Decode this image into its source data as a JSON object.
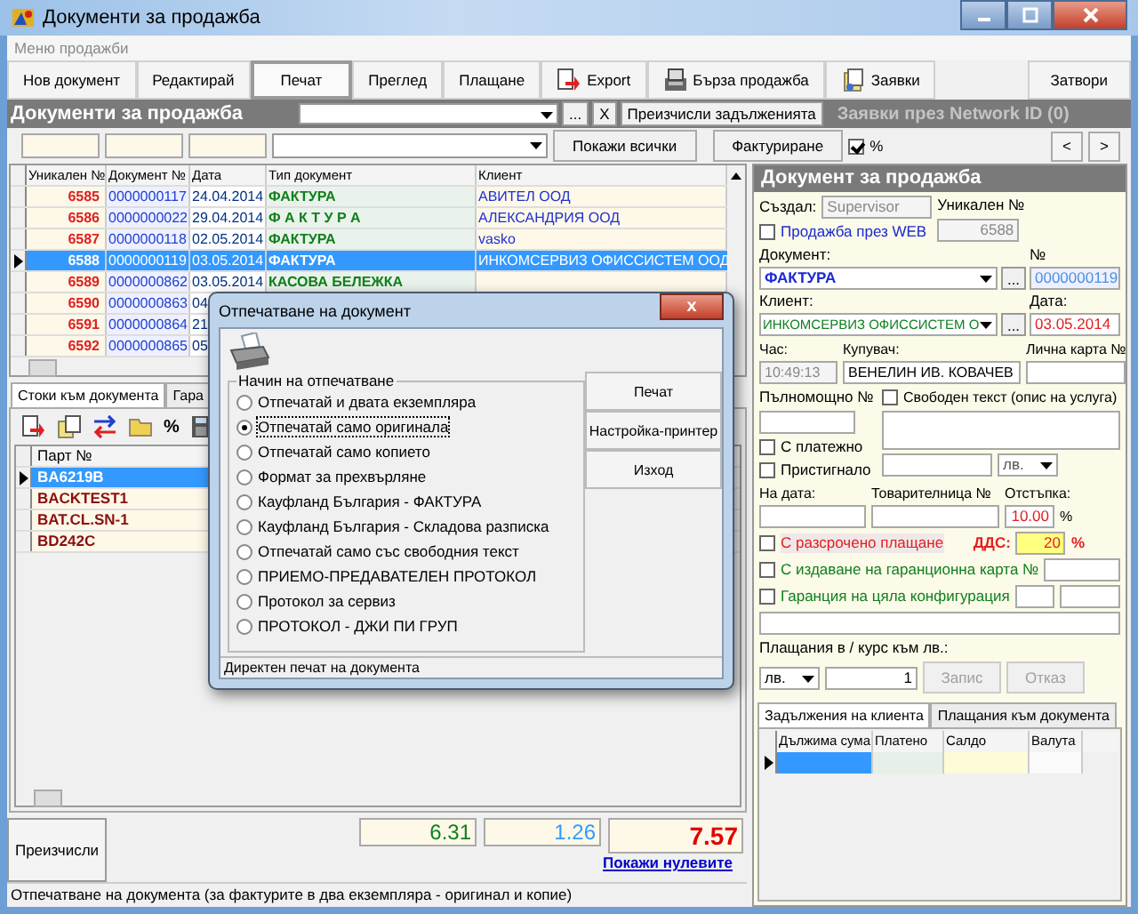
{
  "window": {
    "title": "Документи за продажба"
  },
  "menu": [
    "Меню продажби"
  ],
  "toolbar": [
    {
      "label": "Нов документ",
      "kind": "text",
      "selected": false
    },
    {
      "label": "Редактирай",
      "kind": "text",
      "selected": false
    },
    {
      "label": "Печат",
      "kind": "text",
      "selected": true
    },
    {
      "label": "Преглед",
      "kind": "text",
      "selected": false
    },
    {
      "label": "Плащане",
      "kind": "text",
      "selected": false
    },
    {
      "label": "Export",
      "kind": "export",
      "selected": false
    },
    {
      "label": "Бърза продажба",
      "kind": "register",
      "selected": false
    },
    {
      "label": "Заявки",
      "kind": "orders",
      "selected": false
    },
    {
      "label": "Затвори",
      "kind": "right",
      "selected": false
    }
  ],
  "list_header": {
    "title": "Документи за продажба",
    "ellipsis": "...",
    "clear": "X",
    "recalc_button": "Преизчисли задълженията",
    "network_label": "Заявки през Network ID (0)"
  },
  "filter": {
    "show_all": "Покажи всички",
    "invoicing": "Фактуриране",
    "percent": {
      "label": "%",
      "checked": true
    },
    "prev": "<",
    "next": ">"
  },
  "documents": {
    "columns": [
      "Уникален №",
      "Документ №",
      "Дата",
      "Тип документ",
      "Клиент"
    ],
    "rows": [
      {
        "unique": "6585",
        "number": "0000000117",
        "date": "24.04.2014",
        "type": "ФАКТУРА",
        "client": "АВИТЕЛ ООД",
        "selected": false
      },
      {
        "unique": "6586",
        "number": "0000000022",
        "date": "29.04.2014",
        "type": "Ф А К Т У Р А",
        "client": "АЛЕКСАНДРИЯ ООД",
        "selected": false
      },
      {
        "unique": "6587",
        "number": "0000000118",
        "date": "02.05.2014",
        "type": "ФАКТУРА",
        "client": "vasko",
        "selected": false
      },
      {
        "unique": "6588",
        "number": "0000000119",
        "date": "03.05.2014",
        "type": "ФАКТУРА",
        "client": "ИНКОМСЕРВИЗ ОФИССИСТЕМ ООД",
        "selected": true
      },
      {
        "unique": "6589",
        "number": "0000000862",
        "date": "03.05.2014",
        "type": "КАСОВА БЕЛЕЖКА",
        "selected": false
      },
      {
        "unique": "6590",
        "number": "0000000863",
        "date": "04",
        "selected": false
      },
      {
        "unique": "6591",
        "number": "0000000864",
        "date": "21",
        "selected": false
      },
      {
        "unique": "6592",
        "number": "0000000865",
        "date": "05",
        "selected": false
      }
    ]
  },
  "lower_tabs": [
    {
      "label": "Стоки към документа",
      "selected": true
    },
    {
      "label": "Гара",
      "selected": false
    }
  ],
  "items_toolbar": {
    "percent": "%"
  },
  "items": {
    "columns": [
      "Парт №"
    ],
    "rows": [
      {
        "part": "BA6219B",
        "selected": true
      },
      {
        "part": "BACKTEST1",
        "selected": false
      },
      {
        "part": "BAT.CL.SN-1",
        "selected": false
      },
      {
        "part": "BD242C",
        "selected": false
      }
    ]
  },
  "totals": {
    "recalc": "Преизчисли",
    "net": "6.31",
    "vat": "1.26",
    "total": "7.57",
    "show_zero": "Покажи нулевите"
  },
  "status_bar": "Отпечатване на документа (за фактурите в два екземпляра - оригинал и копие)",
  "document": {
    "title": "Документ за продажба",
    "created_by_label": "Създал:",
    "created_by": "Supervisor",
    "unique_label": "Уникален №",
    "unique": "6588",
    "web": {
      "label": "Продажба през WEB",
      "checked": false
    },
    "doc_label": "Документ:",
    "doc": "ФАКТУРА",
    "ellipsis": "...",
    "number_label": "№",
    "number": "0000000119",
    "client_label": "Клиент:",
    "client": "ИНКОМСЕРВИЗ ОФИССИСТЕМ О",
    "date_label": "Дата:",
    "date": "03.05.2014",
    "time_label": "Час:",
    "time": "10:49:13",
    "buyer_label": "Купувач:",
    "buyer": "ВЕНЕЛИН ИВ. КОВАЧЕВ",
    "id_label": "Лична карта №",
    "proxy_label": "Пълномощно №",
    "free_text": {
      "label": "Свободен текст (опис на услуга)",
      "checked": false
    },
    "payment_order": {
      "label": "С платежно",
      "checked": false
    },
    "arrived": {
      "label": "Пристигнало",
      "checked": false
    },
    "currency": "лв.",
    "on_date_label": "На дата:",
    "waybill_label": "Товарителница №",
    "discount_label": "Отстъпка:",
    "discount": "10.00",
    "percent": "%",
    "installments": {
      "label": "С разсрочено плащане",
      "checked": false
    },
    "vat_label": "ДДС:",
    "vat": "20",
    "vat_percent": "%",
    "warranty_card": {
      "label": "С издаване на гаранционна карта №",
      "checked": false
    },
    "warranty_config": {
      "label": "Гаранция на цяла конфигурация",
      "checked": false
    },
    "payments_label": "Плащания в / курс към лв.:",
    "payment_currency": "лв.",
    "rate": "1",
    "save": "Запис",
    "cancel": "Отказ",
    "tabs": [
      {
        "label": "Задължения на клиента",
        "selected": true
      },
      {
        "label": "Плащания към документа",
        "selected": false
      }
    ],
    "columns": [
      "Дължима сума",
      "Платено",
      "Салдо",
      "Валута"
    ]
  },
  "print_dialog": {
    "title": "Отпечатване на документ",
    "close": "x",
    "group": "Начин на отпечатване",
    "options": [
      {
        "label": "Отпечатай и двата екземпляра",
        "selected": false
      },
      {
        "label": "Отпечатай само оригинала",
        "selected": true
      },
      {
        "label": "Отпечатай само копието",
        "selected": false
      },
      {
        "label": "Формат за прехвърляне",
        "selected": false
      },
      {
        "label": "Кауфланд България - ФАКТУРА",
        "selected": false
      },
      {
        "label": "Кауфланд България - Складова разписка",
        "selected": false
      },
      {
        "label": "Отпечатай само със свободния текст",
        "selected": false
      },
      {
        "label": "ПРИЕМО-ПРЕДАВАТЕЛЕН ПРОТОКОЛ",
        "selected": false
      },
      {
        "label": "Протокол за сервиз",
        "selected": false
      },
      {
        "label": "ПРОТОКОЛ - ДЖИ ПИ ГРУП",
        "selected": false
      }
    ],
    "buttons": [
      "Печат",
      "Настройка-принтер",
      "Изход"
    ],
    "status": "Директен печат на документа"
  }
}
